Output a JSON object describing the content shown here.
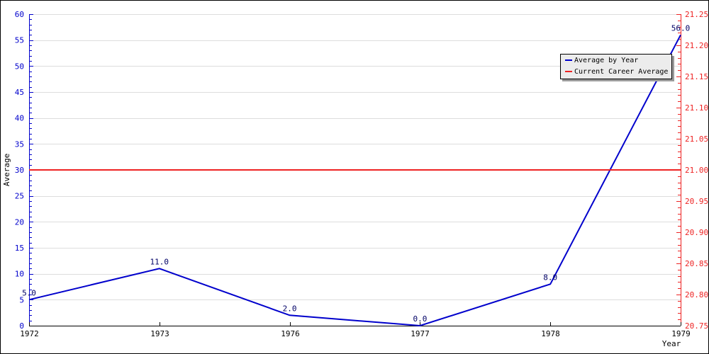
{
  "chart_data": {
    "type": "line",
    "title": "",
    "xlabel": "Year",
    "ylabel": "Average",
    "categories": [
      "1972",
      "1973",
      "1976",
      "1977",
      "1978",
      "1979"
    ],
    "series": [
      {
        "name": "Average by Year",
        "color": "#0000cc",
        "axis": "left",
        "values": [
          5.0,
          11.0,
          2.0,
          0.0,
          8.0,
          56.0
        ],
        "labels": [
          "5.0",
          "11.0",
          "2.0",
          "0.0",
          "8.0",
          "56.0"
        ]
      },
      {
        "name": "Current Career Average",
        "color": "#ee2222",
        "axis": "right",
        "values": [
          21.0,
          21.0,
          21.0,
          21.0,
          21.0,
          21.0
        ]
      }
    ],
    "y_left": {
      "range": [
        0,
        60
      ],
      "major_step": 5,
      "minor_step": 1,
      "ticks": [
        "0",
        "5",
        "10",
        "15",
        "20",
        "25",
        "30",
        "35",
        "40",
        "45",
        "50",
        "55",
        "60"
      ],
      "color": "#0000cc"
    },
    "y_right": {
      "range": [
        20.75,
        21.25
      ],
      "major_step": 0.05,
      "minor_step": 0.01,
      "ticks": [
        "20.75",
        "20.80",
        "20.85",
        "20.90",
        "20.95",
        "21.00",
        "21.05",
        "21.10",
        "21.15",
        "21.20",
        "21.25"
      ],
      "color": "#ee2222"
    },
    "grid": true,
    "legend_position": "top-right"
  },
  "legend": {
    "items": [
      {
        "label": "Average by Year",
        "color": "#0000cc"
      },
      {
        "label": "Current Career Average",
        "color": "#ee2222"
      }
    ]
  }
}
